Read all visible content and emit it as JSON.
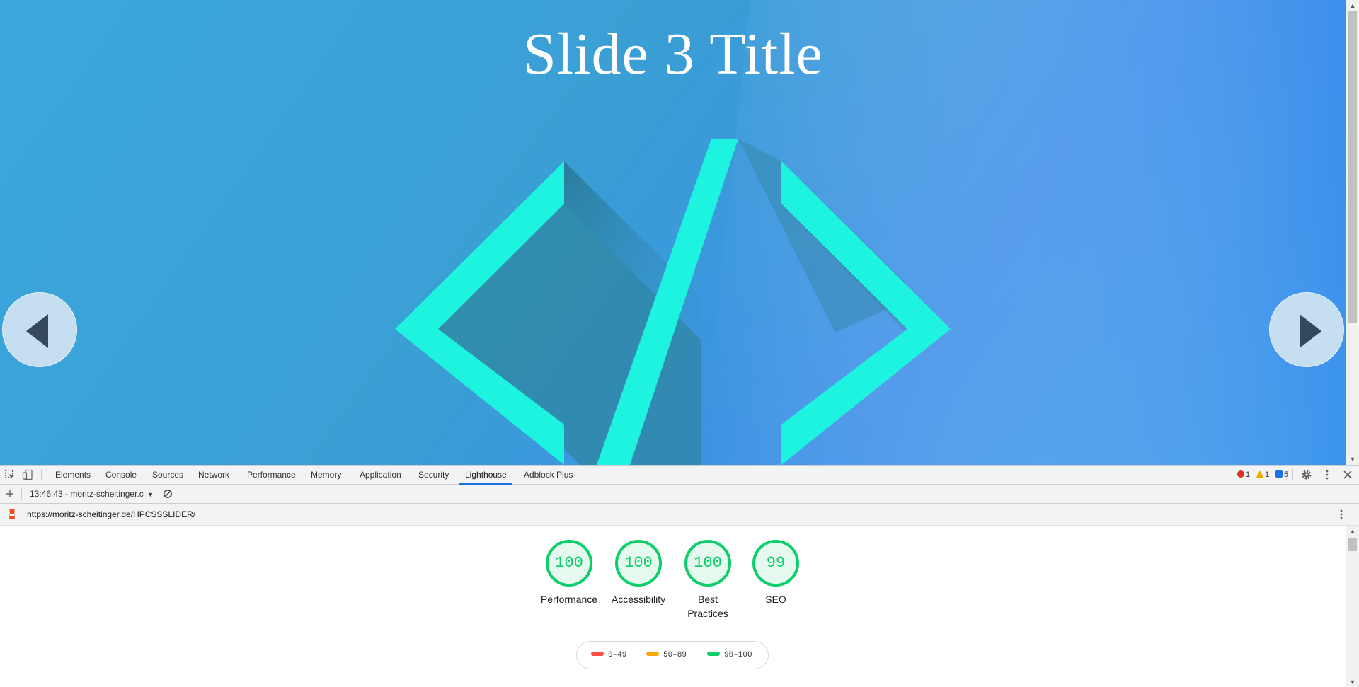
{
  "slide": {
    "title": "Slide 3 Title",
    "prev_icon": "triangle-left-icon",
    "next_icon": "triangle-right-icon",
    "art_icon": "code-brackets-icon",
    "colors": {
      "background": "#3aa1e6",
      "art": "#1ef3e0",
      "arrow_bg": "#c5def0",
      "arrow_glyph": "#34495e"
    }
  },
  "devtools": {
    "tabs": [
      {
        "label": "Elements"
      },
      {
        "label": "Console"
      },
      {
        "label": "Sources"
      },
      {
        "label": "Network"
      },
      {
        "label": "Performance"
      },
      {
        "label": "Memory"
      },
      {
        "label": "Application"
      },
      {
        "label": "Security"
      },
      {
        "label": "Lighthouse",
        "active": true
      },
      {
        "label": "Adblock Plus"
      }
    ],
    "counts": {
      "errors": "1",
      "warnings": "1",
      "messages": "5"
    },
    "toolbar": {
      "report_select": "13:46:43 - moritz-scheitinger.c"
    },
    "report_url": "https://moritz-scheitinger.de/HPCSSSLIDER/"
  },
  "lighthouse": {
    "gauges": [
      {
        "score": "100",
        "label": "Performance"
      },
      {
        "score": "100",
        "label": "Accessibility"
      },
      {
        "score": "100",
        "label": "Best Practices"
      },
      {
        "score": "99",
        "label": "SEO"
      }
    ],
    "legend": [
      {
        "range": "0–49",
        "color": "#ff4e42"
      },
      {
        "range": "50–89",
        "color": "#ffa400"
      },
      {
        "range": "90–100",
        "color": "#0cce6b"
      }
    ],
    "pass_color": "#0cce6b"
  }
}
